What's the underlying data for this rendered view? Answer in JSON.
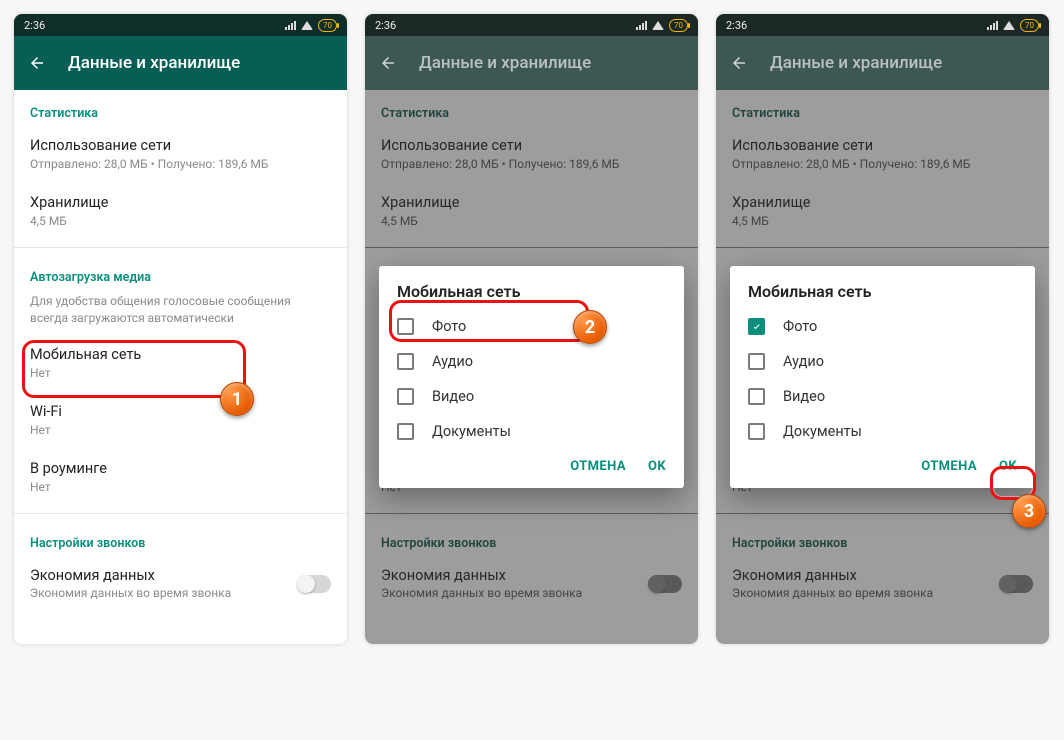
{
  "status": {
    "time": "2:36",
    "battery": "70"
  },
  "appbar": {
    "title": "Данные и хранилище"
  },
  "section_stats": "Статистика",
  "net_usage": {
    "title": "Использование сети",
    "sub": "Отправлено: 28,0 МБ • Получено: 189,6 МБ"
  },
  "storage": {
    "title": "Хранилище",
    "sub": "4,5 МБ"
  },
  "section_autodl": "Автозагрузка медиа",
  "autodl_hint": "Для удобства общения голосовые сообщения всегда загружаются автоматически",
  "mobile": {
    "title": "Мобильная сеть",
    "sub": "Нет"
  },
  "wifi": {
    "title": "Wi-Fi",
    "sub": "Нет"
  },
  "roaming": {
    "title": "В роуминге",
    "sub": "Нет"
  },
  "section_calls": "Настройки звонков",
  "data_saver": {
    "title": "Экономия данных",
    "sub": "Экономия данных во время звонка"
  },
  "dialog": {
    "title": "Мобильная сеть",
    "opts": {
      "photo": "Фото",
      "audio": "Аудио",
      "video": "Видео",
      "docs": "Документы"
    },
    "cancel": "ОТМЕНА",
    "ok": "OK"
  },
  "badges": {
    "b1": "1",
    "b2": "2",
    "b3": "3"
  }
}
